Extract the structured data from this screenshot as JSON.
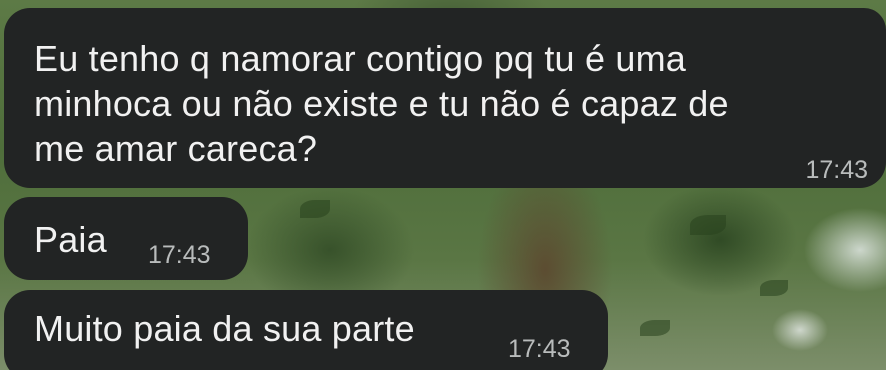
{
  "messages": [
    {
      "text": "Eu tenho q namorar contigo pq tu é uma\nminhoca ou não existe e tu não é capaz de\nme amar careca?",
      "time": "17:43"
    },
    {
      "text": "Paia",
      "time": "17:43"
    },
    {
      "text": "Muito paia da sua parte",
      "time": "17:43"
    }
  ],
  "colors": {
    "bubble_background": "#222424",
    "message_text": "#f1f1f1",
    "timestamp_text": "#b9bcbc"
  },
  "background": "photo of tree foliage and trunk"
}
